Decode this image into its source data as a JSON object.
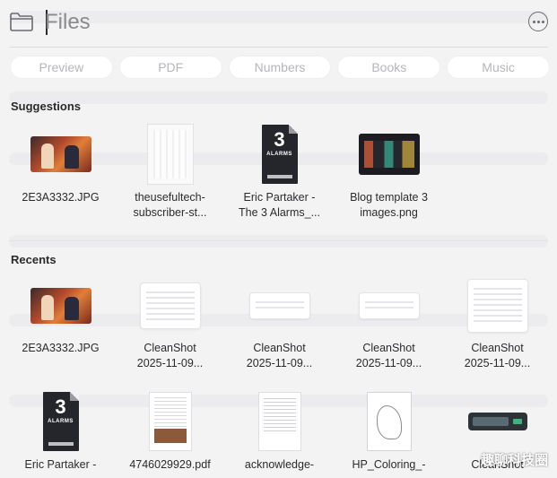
{
  "header": {
    "search_placeholder": "Files",
    "folder_icon": "folder-icon",
    "more_icon": "ellipsis-circle-icon"
  },
  "filters": [
    "Preview",
    "PDF",
    "Numbers",
    "Books",
    "Music"
  ],
  "suggestions": {
    "title": "Suggestions",
    "items": [
      {
        "line1": "2E3A3332.JPG",
        "line2": ""
      },
      {
        "line1": "theusefultech-",
        "line2": "subscriber-st..."
      },
      {
        "line1": "Eric Partaker -",
        "line2": "The 3 Alarms_..."
      },
      {
        "line1": "Blog template 3",
        "line2": "images.png"
      }
    ]
  },
  "recents": {
    "title": "Recents",
    "items": [
      {
        "line1": "2E3A3332.JPG",
        "line2": ""
      },
      {
        "line1": "CleanShot",
        "line2": "2025-11-09..."
      },
      {
        "line1": "CleanShot",
        "line2": "2025-11-09..."
      },
      {
        "line1": "CleanShot",
        "line2": "2025-11-09..."
      },
      {
        "line1": "CleanShot",
        "line2": "2025-11-09..."
      },
      {
        "line1": "Eric Partaker -",
        "line2": ""
      },
      {
        "line1": "4746029929.pdf",
        "line2": ""
      },
      {
        "line1": "acknowledge-",
        "line2": ""
      },
      {
        "line1": "HP_Coloring_-",
        "line2": ""
      },
      {
        "line1": "CleanShot",
        "line2": ""
      }
    ]
  },
  "book_cover": {
    "number": "3",
    "title": "ALARMS"
  },
  "watermark": "趣聊科技圈"
}
